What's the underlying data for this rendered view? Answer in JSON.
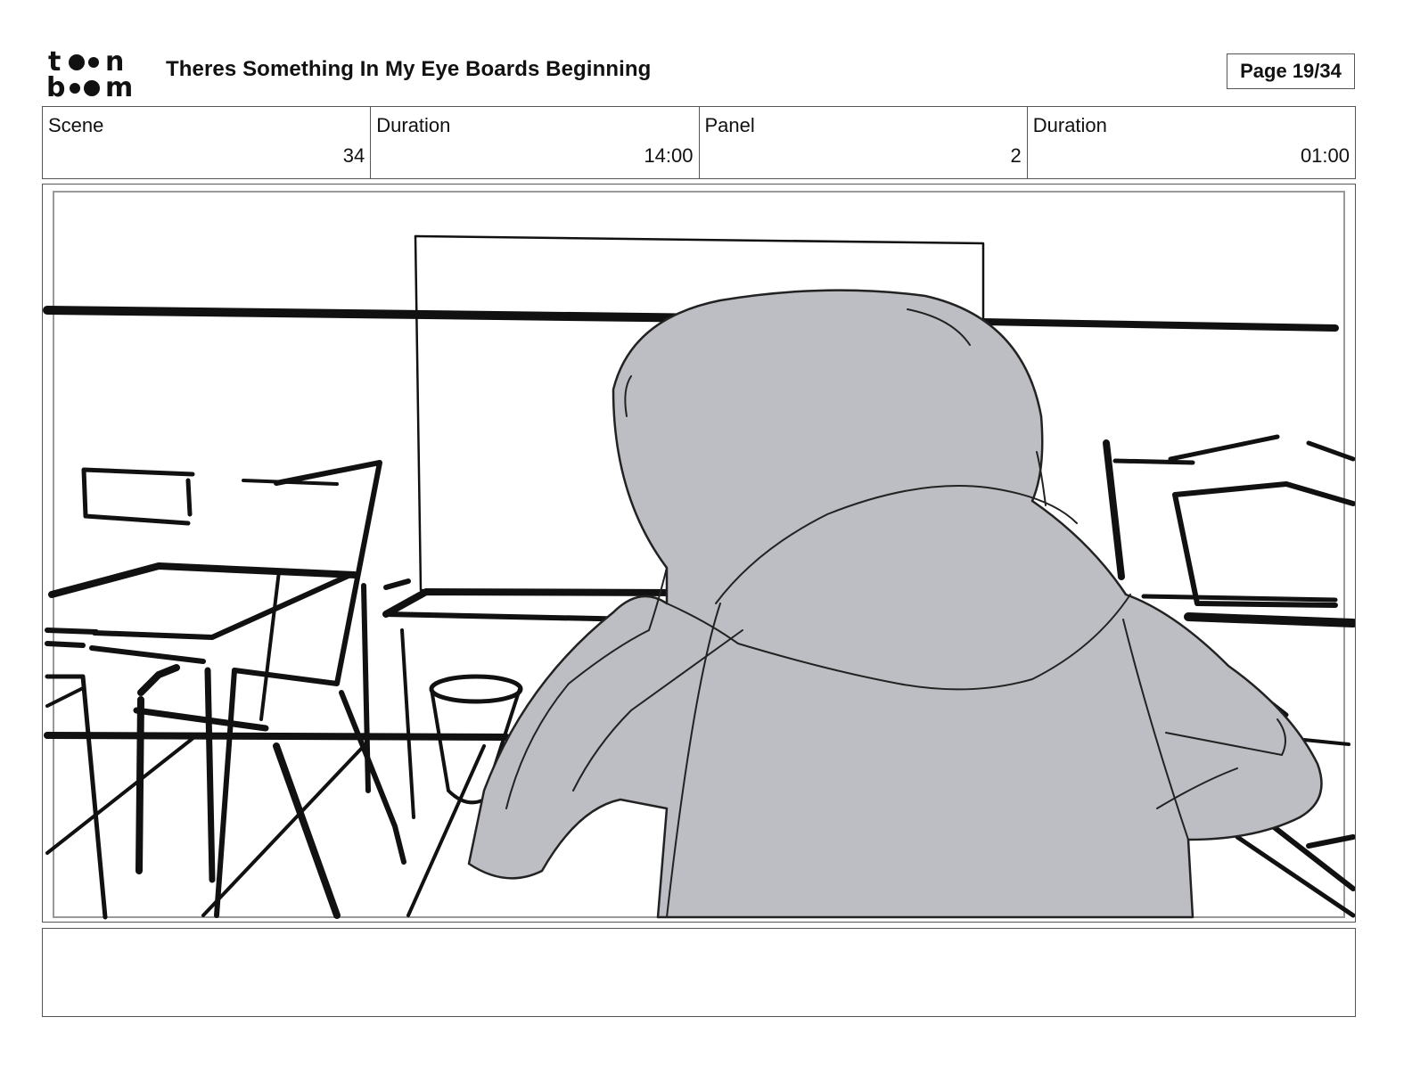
{
  "header": {
    "logo_line1": "toon",
    "logo_line2": "boom",
    "title": "Theres Something In My Eye Boards Beginning",
    "page": "Page 19/34"
  },
  "info": [
    {
      "label": "Scene",
      "value": "34"
    },
    {
      "label": "Duration",
      "value": "14:00"
    },
    {
      "label": "Panel",
      "value": "2"
    },
    {
      "label": "Duration",
      "value": "01:00"
    }
  ],
  "colors": {
    "ink": "#111111",
    "figure_fill": "#bdbec3",
    "frame": "#555555"
  },
  "notes": ""
}
